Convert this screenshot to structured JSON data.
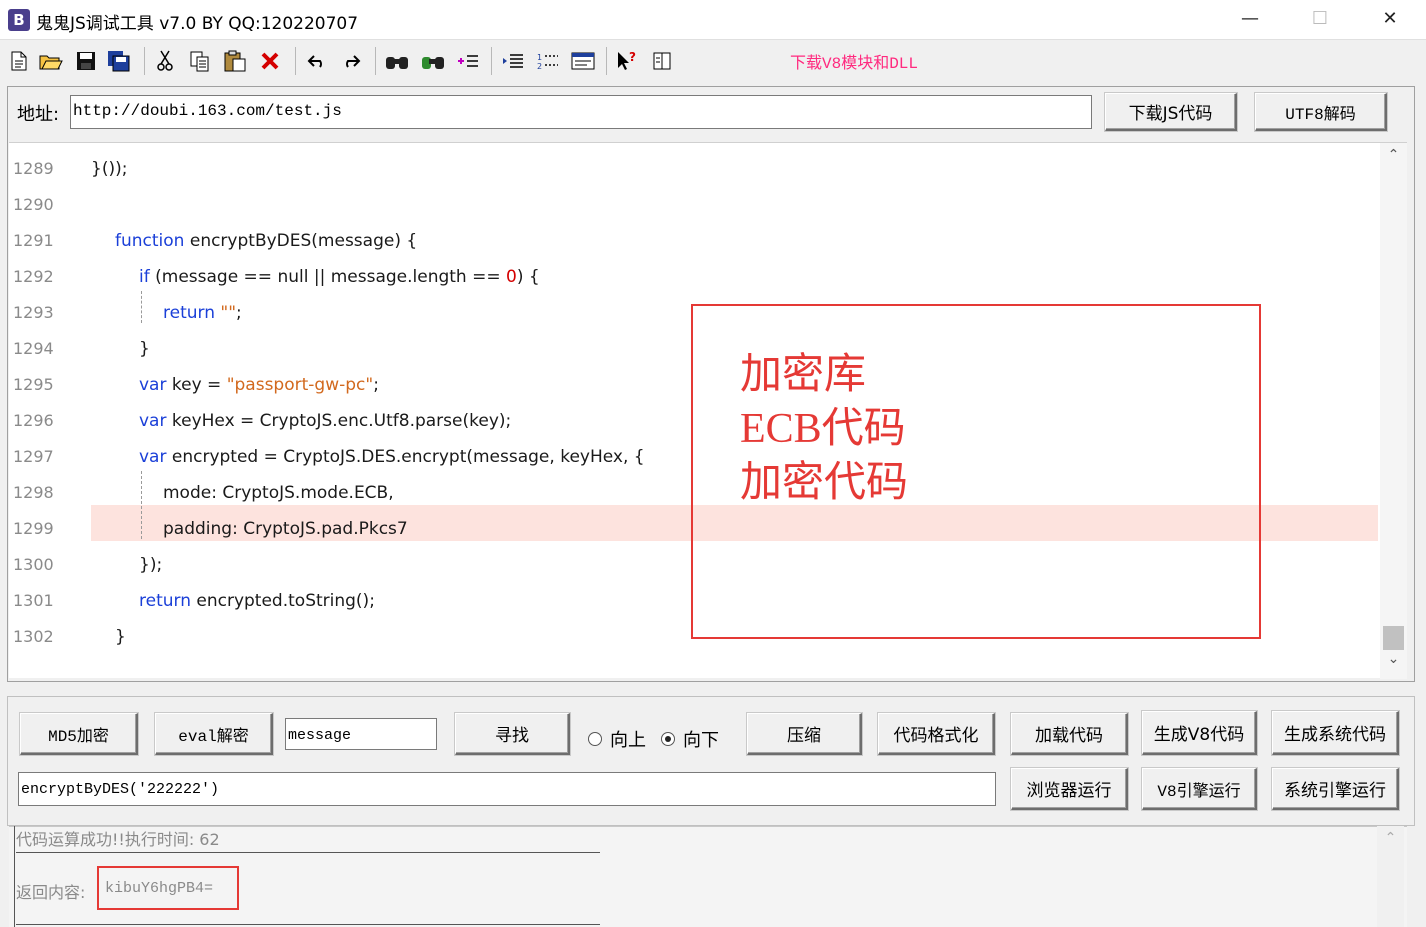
{
  "window": {
    "title": "鬼鬼JS调试工具 v7.0 BY QQ:120220707",
    "app_icon_letter": "B",
    "minimize": "—",
    "maximize": "☐",
    "close": "✕"
  },
  "toolbar": {
    "icons": [
      "new-file-icon",
      "open-folder-icon",
      "save-icon",
      "save-all-icon",
      "cut-icon",
      "copy-icon",
      "paste-icon",
      "delete-icon",
      "undo-icon",
      "redo-icon",
      "find-icon",
      "find-next-icon",
      "replace-icon",
      "indent-icon",
      "line-numbers-icon",
      "window-icon",
      "help-cursor-icon",
      "panel-icon"
    ],
    "download_v8_link": "下载V8模块和DLL"
  },
  "address": {
    "label": "地址:",
    "value": "http://doubi.163.com/test.js",
    "download_js_button": "下载JS代码",
    "utf8_decode_button": "UTF8解码"
  },
  "editor": {
    "line_numbers": [
      "1289",
      "1290",
      "1291",
      "1292",
      "1293",
      "1294",
      "1295",
      "1296",
      "1297",
      "1298",
      "1299",
      "1300",
      "1301",
      "1302"
    ],
    "lines": [
      {
        "plain": "}());"
      },
      {
        "plain": ""
      },
      {
        "kw": "function",
        "rest": " encryptByDES(message) {"
      },
      {
        "kw": "if",
        "rest_a": " (message == null || message.length == ",
        "num": "0",
        "rest_b": ") {"
      },
      {
        "kw": "return",
        "str": " \"\"",
        "rest": ";"
      },
      {
        "plain": "}"
      },
      {
        "kw": "var",
        "rest_a": " key = ",
        "str": "\"passport-gw-pc\"",
        "rest_b": ";"
      },
      {
        "kw": "var",
        "rest": " keyHex = CryptoJS.enc.Utf8.parse(key);"
      },
      {
        "kw": "var",
        "rest": " encrypted = CryptoJS.DES.encrypt(message, keyHex, {"
      },
      {
        "plain": "mode: CryptoJS.mode.ECB,"
      },
      {
        "plain": "padding: CryptoJS.pad.Pkcs7"
      },
      {
        "plain": "});"
      },
      {
        "kw": "return",
        "rest": " encrypted.toString();"
      },
      {
        "plain": "}"
      }
    ],
    "highlighted_line": "1299"
  },
  "annotation": {
    "lines": [
      "加密库",
      "ECB代码",
      "加密代码"
    ],
    "color": "#e53935"
  },
  "controls": {
    "md5_button": "MD5加密",
    "eval_button": "eval解密",
    "search_value": "message",
    "find_button": "寻找",
    "radio_up": "向上",
    "radio_down": "向下",
    "radio_selected": "向下",
    "compress_button": "压缩",
    "format_button": "代码格式化",
    "load_button": "加载代码",
    "gen_v8_button": "生成V8代码",
    "gen_sys_button": "生成系统代码",
    "call_value": "encryptByDES('222222')",
    "browser_run_button": "浏览器运行",
    "v8_run_button": "V8引擎运行",
    "sys_run_button": "系统引擎运行"
  },
  "output": {
    "status": "代码运算成功!!执行时间: 62",
    "return_label": "返回内容:",
    "return_value": "kibuY6hgPB4="
  }
}
